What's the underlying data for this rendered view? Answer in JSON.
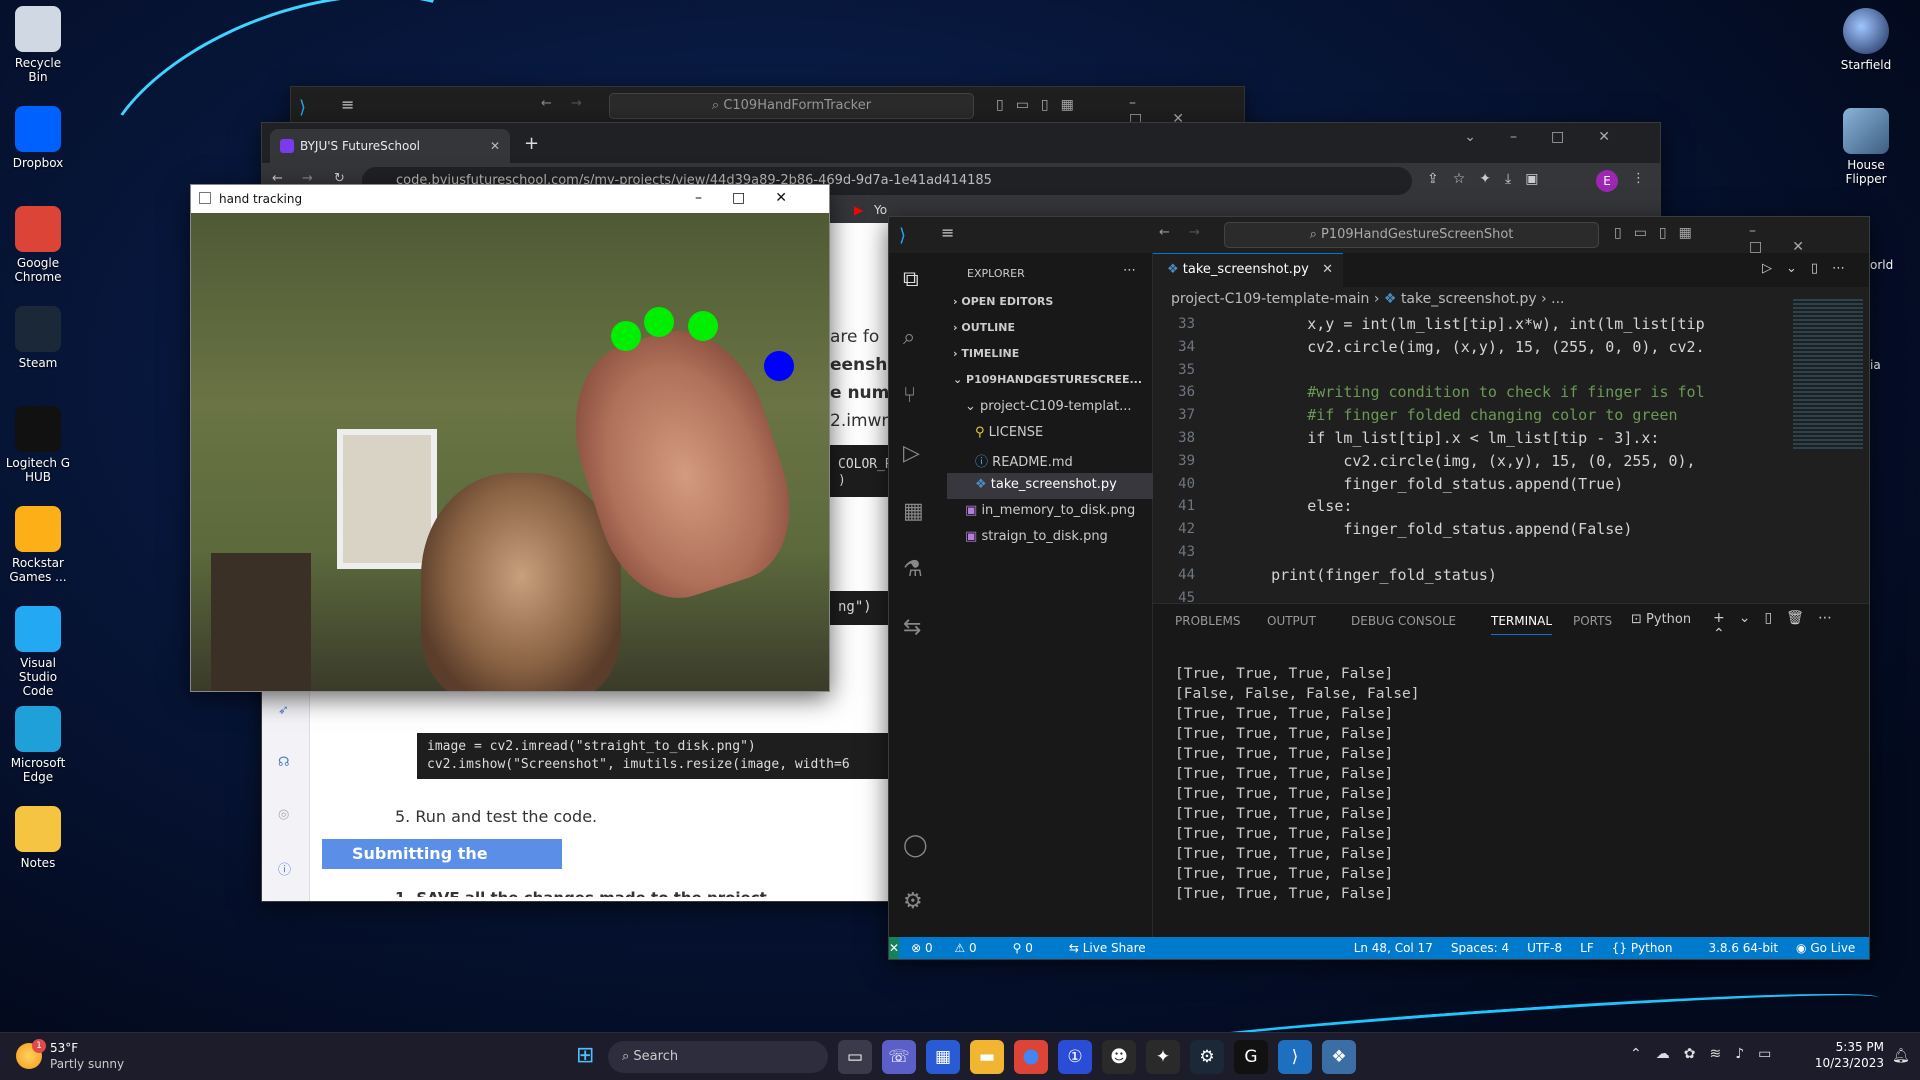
{
  "desktop": {
    "left_icons": [
      {
        "label": "Recycle Bin",
        "icon": "recycle-bin-icon",
        "color": "#cfd8e3"
      },
      {
        "label": "Dropbox",
        "icon": "dropbox-icon",
        "color": "#0061ff"
      },
      {
        "label": "Google Chrome",
        "icon": "chrome-icon",
        "color": "#db4437"
      },
      {
        "label": "Steam",
        "icon": "steam-icon",
        "color": "#1b2838"
      },
      {
        "label": "Logitech G HUB",
        "icon": "logitech-icon",
        "color": "#111111"
      },
      {
        "label": "Rockstar Games ...",
        "icon": "rockstar-icon",
        "color": "#fcaf17"
      },
      {
        "label": "Visual Studio Code",
        "icon": "vscode-icon",
        "color": "#23a9f2"
      },
      {
        "label": "Microsoft Edge",
        "icon": "edge-icon",
        "color": "#1fa0d8"
      },
      {
        "label": "Notes",
        "icon": "folder-icon",
        "color": "#f5c542"
      }
    ],
    "right_icons": [
      {
        "label": "Starfield",
        "icon": "starfield-icon"
      },
      {
        "label": "House Flipper",
        "icon": "house-flipper-icon"
      },
      {
        "label": "orld"
      },
      {
        "label": "ia"
      }
    ]
  },
  "vscode_back": {
    "search": "C109HandFormTracker"
  },
  "browser": {
    "tab_title": "BYJU'S FutureSchool",
    "url": "code.byjusfutureschool.com/s/my-projects/view/44d39a89-2b86-469d-9d7a-1e41ad414185",
    "bookmark_yt": "Yo",
    "profile_letter": "E",
    "content": {
      "snippets": [
        "are fo",
        "eensho",
        "e num",
        "2.imwri",
        "COLOR_R",
        ")",
        "ng\")"
      ],
      "code_lines": [
        "image = cv2.imread(\"straight_to_disk.png\")",
        "cv2.imshow(\"Screenshot\", imutils.resize(image, width=6"
      ],
      "step5": "5. Run and test the code.",
      "section_title": "Submitting the Project:",
      "cut_text": "1. SAVE all the changes made to the project"
    }
  },
  "hand_window": {
    "title": "hand tracking"
  },
  "vscode": {
    "search": "P109HandGestureScreenShot",
    "explorer_title": "EXPLORER",
    "sections": [
      "OPEN EDITORS",
      "OUTLINE",
      "TIMELINE",
      "P109HANDGESTURESCREE..."
    ],
    "folder": "project-C109-templat...",
    "files": [
      {
        "name": "LICENSE",
        "icon": "license-icon"
      },
      {
        "name": "README.md",
        "icon": "info-icon"
      },
      {
        "name": "take_screenshot.py",
        "icon": "python-icon"
      },
      {
        "name": "in_memory_to_disk.png",
        "icon": "image-icon"
      },
      {
        "name": "straign_to_disk.png",
        "icon": "image-icon"
      }
    ],
    "tab": "take_screenshot.py",
    "breadcrumb": [
      "project-C109-template-main",
      "take_screenshot.py",
      "..."
    ],
    "line_numbers": [
      "33",
      "34",
      "35",
      "36",
      "37",
      "38",
      "39",
      "40",
      "41",
      "42",
      "43",
      "44",
      "45"
    ],
    "code": [
      "        x,y = int(lm_list[tip].x*w), int(lm_list[tip",
      "        cv2.circle(img, (x,y), 15, (255, 0, 0), cv2.",
      "",
      "        #writing condition to check if finger is fol",
      "        #if finger folded changing color to green",
      "        if lm_list[tip].x < lm_list[tip - 3].x:",
      "            cv2.circle(img, (x,y), 15, (0, 255, 0), ",
      "            finger_fold_status.append(True)",
      "        else:",
      "            finger_fold_status.append(False)",
      "",
      "    print(finger_fold_status)",
      ""
    ],
    "panel_tabs": [
      "PROBLEMS",
      "OUTPUT",
      "DEBUG CONSOLE",
      "TERMINAL",
      "PORTS"
    ],
    "terminal_label": "Python",
    "terminal_lines": [
      "[True, True, True, False]",
      "[False, False, False, False]",
      "[True, True, True, False]",
      "[True, True, True, False]",
      "[True, True, True, False]",
      "[True, True, True, False]",
      "[True, True, True, False]",
      "[True, True, True, False]",
      "[True, True, True, False]",
      "[True, True, True, False]",
      "[True, True, True, False]",
      "[True, True, True, False]"
    ],
    "status": {
      "errors": "0",
      "warnings": "0",
      "ports": "0",
      "live_share": "Live Share",
      "position": "Ln 48, Col 17",
      "spaces": "Spaces: 4",
      "encoding": "UTF-8",
      "eol": "LF",
      "language": "Python",
      "interpreter": "3.8.6 64-bit",
      "go_live": "Go Live"
    }
  },
  "taskbar": {
    "weather_temp": "53°F",
    "weather_desc": "Partly sunny",
    "weather_badge": "1",
    "search": "Search",
    "time": "5:35 PM",
    "date": "10/23/2023"
  }
}
